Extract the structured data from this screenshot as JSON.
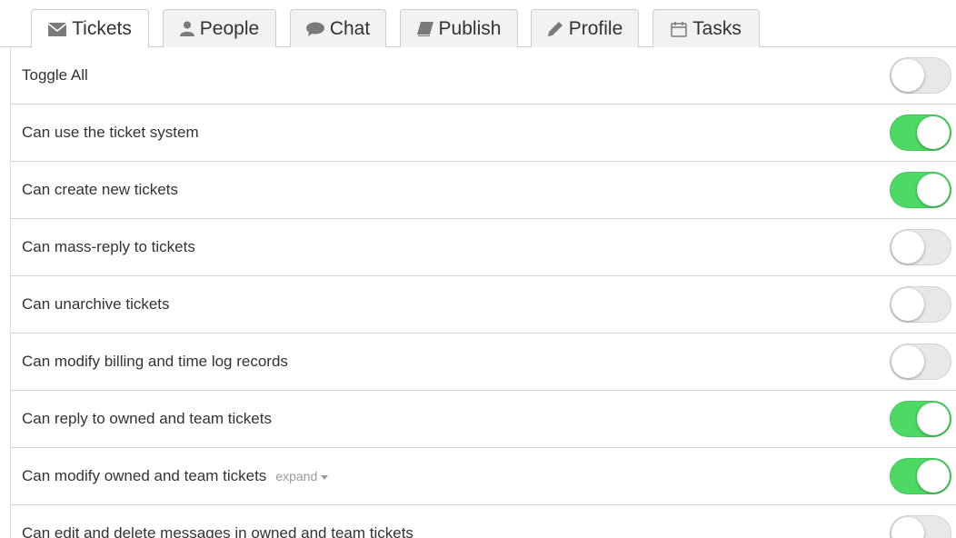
{
  "tabs": [
    {
      "label": "Tickets",
      "icon": "envelope-icon",
      "active": true
    },
    {
      "label": "People",
      "icon": "user-icon",
      "active": false
    },
    {
      "label": "Chat",
      "icon": "chat-bubble-icon",
      "active": false
    },
    {
      "label": "Publish",
      "icon": "book-icon",
      "active": false
    },
    {
      "label": "Profile",
      "icon": "pencil-icon",
      "active": false
    },
    {
      "label": "Tasks",
      "icon": "calendar-icon",
      "active": false
    }
  ],
  "permissions": [
    {
      "label": "Toggle All",
      "enabled": false
    },
    {
      "label": "Can use the ticket system",
      "enabled": true
    },
    {
      "label": "Can create new tickets",
      "enabled": true
    },
    {
      "label": "Can mass-reply to tickets",
      "enabled": false
    },
    {
      "label": "Can unarchive tickets",
      "enabled": false
    },
    {
      "label": "Can modify billing and time log records",
      "enabled": false
    },
    {
      "label": "Can reply to owned and team tickets",
      "enabled": true
    },
    {
      "label": "Can modify owned and team tickets",
      "enabled": true,
      "expand_label": "expand"
    },
    {
      "label": "Can edit and delete messages in owned and team tickets",
      "enabled": false
    }
  ],
  "colors": {
    "toggle_on": "#4cd964",
    "toggle_off": "#e8e8e8",
    "border": "#d6d6d6"
  }
}
